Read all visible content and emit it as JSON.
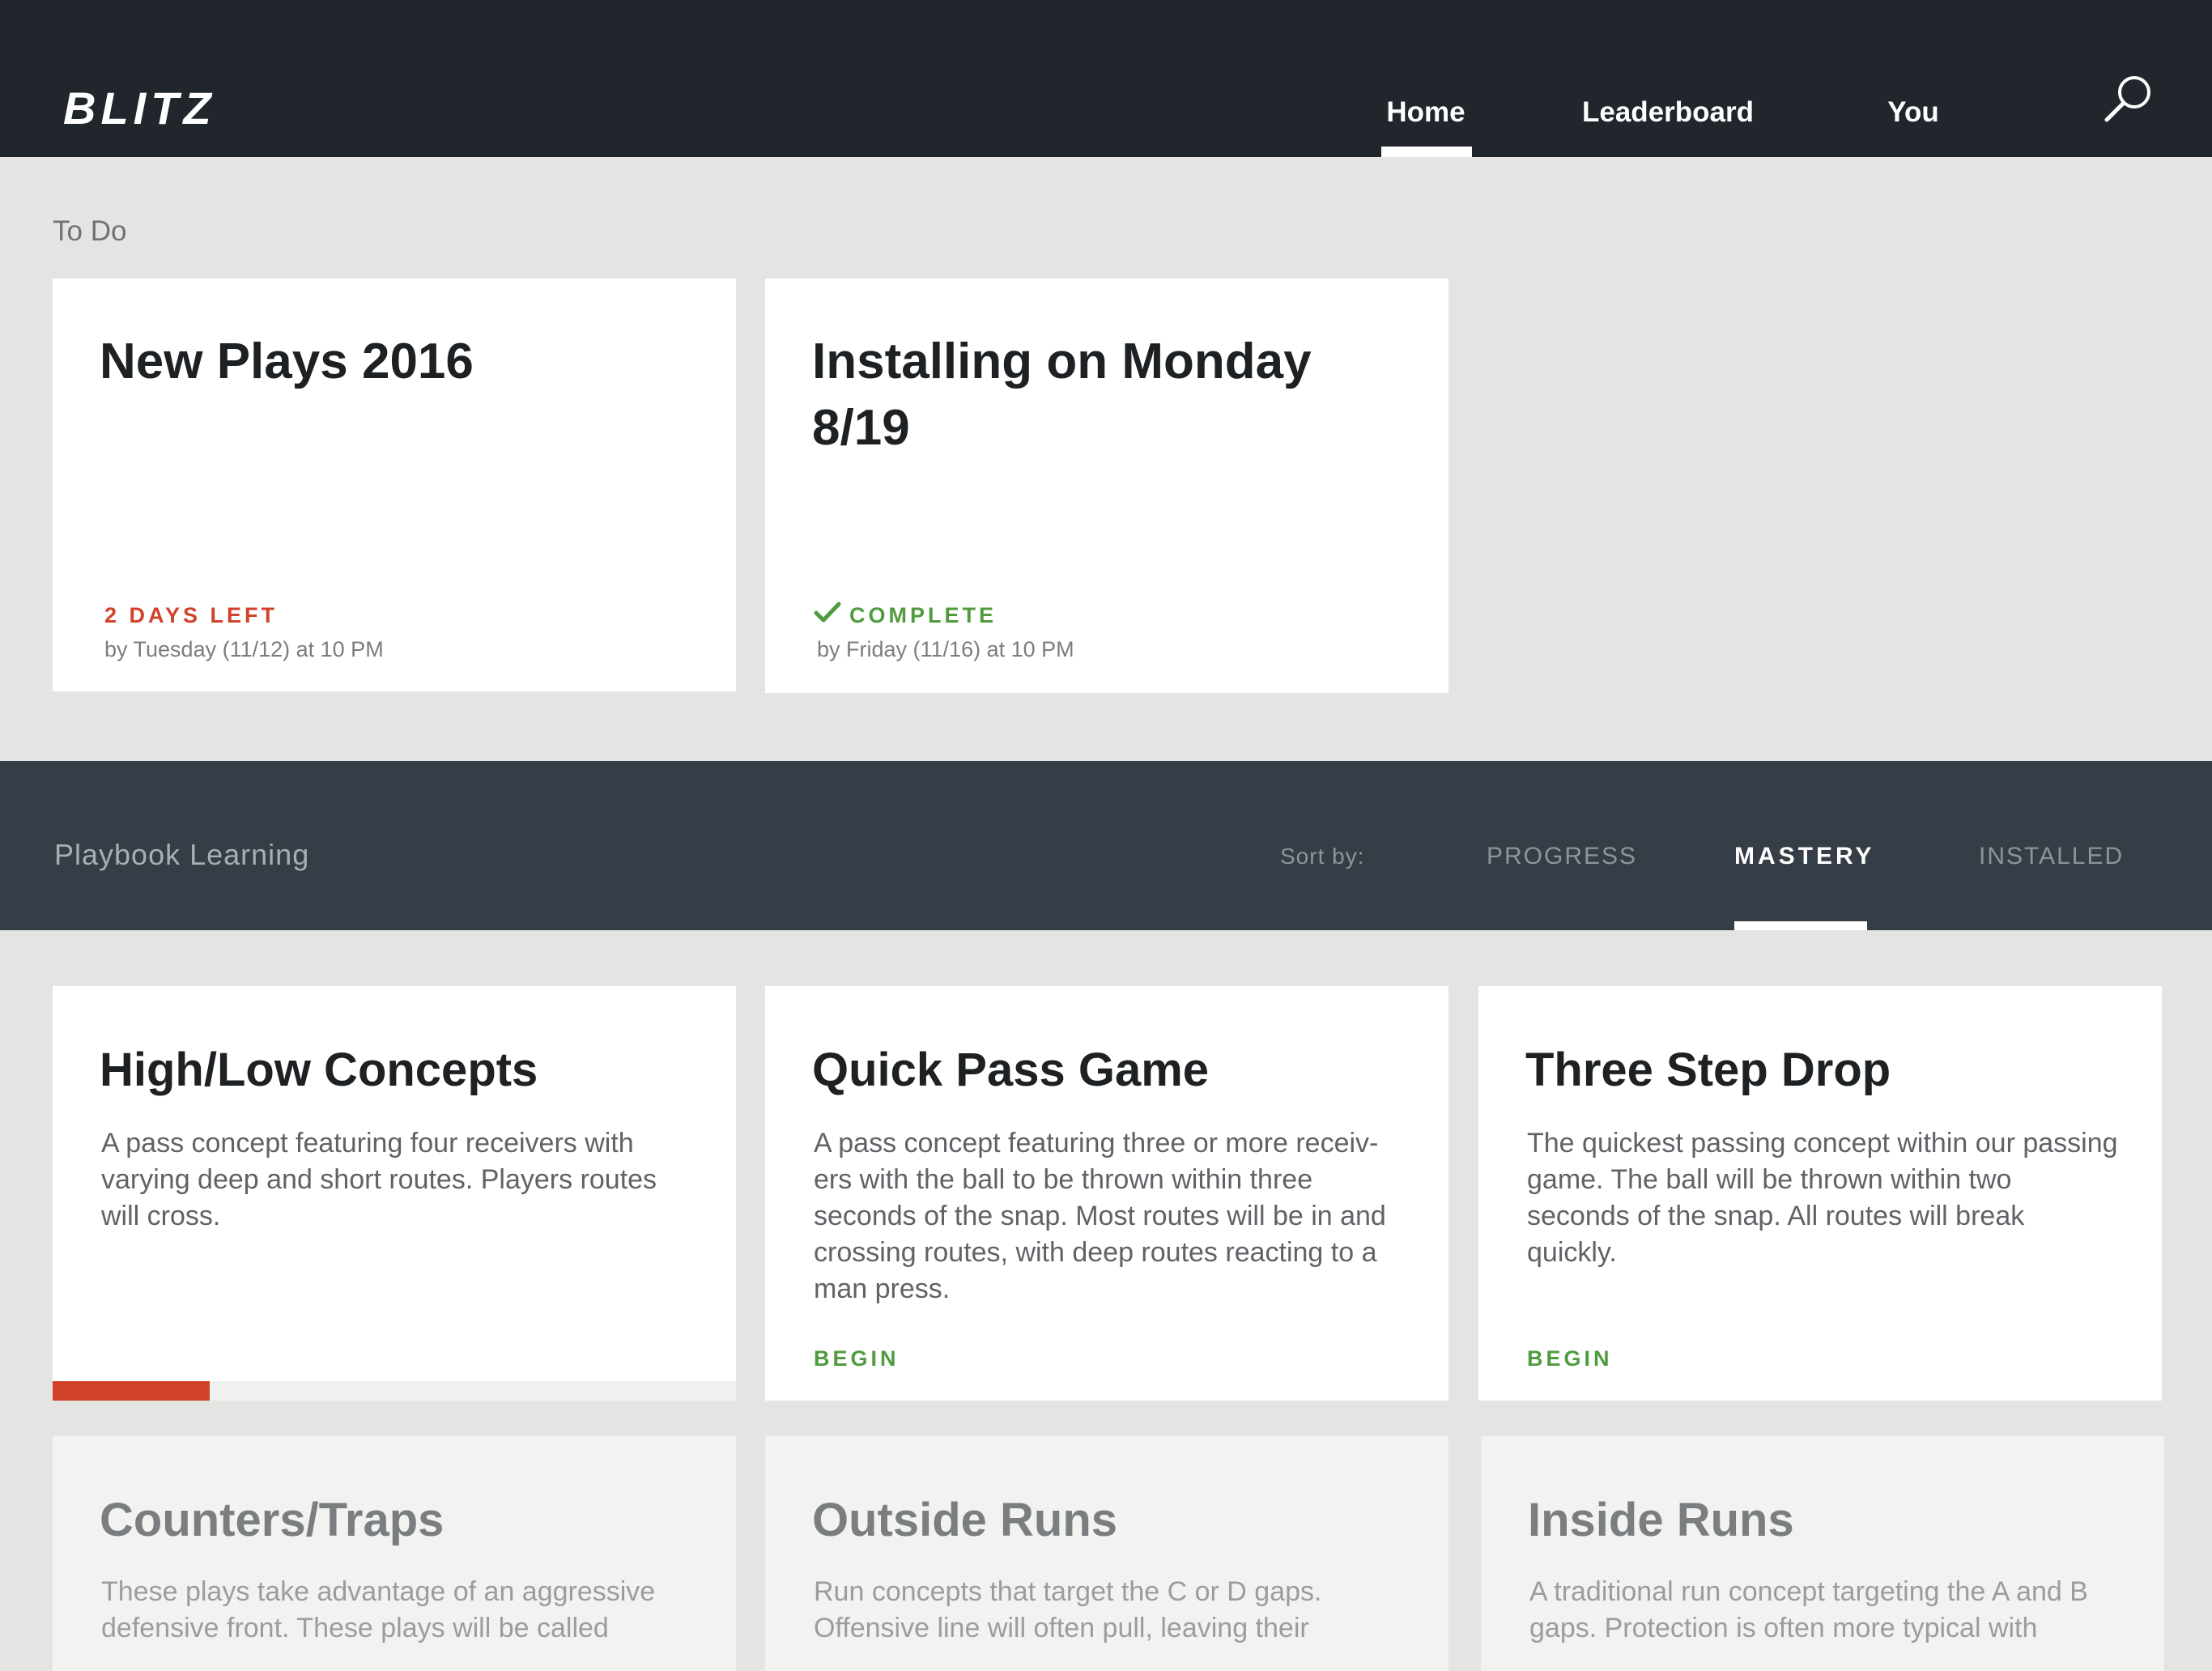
{
  "app": {
    "logo": "BLITZ",
    "nav": [
      {
        "label": "Home",
        "active": true
      },
      {
        "label": "Leaderboard",
        "active": false
      },
      {
        "label": "You",
        "active": false
      }
    ],
    "search_icon": "search-icon"
  },
  "todo": {
    "section_label": "To Do",
    "cards": [
      {
        "title": "New Plays 2016",
        "status": "2 DAYS LEFT",
        "status_color": "#d1422a",
        "due": "by Tuesday (11/12) at 10 PM"
      },
      {
        "title": "Installing on Monday 8/19",
        "status": "COMPLETE",
        "status_color": "#4f9b3e",
        "status_icon": "check-icon",
        "due": "by Friday (11/16) at 10 PM"
      }
    ]
  },
  "playbook": {
    "title": "Playbook Learning",
    "sort_label": "Sort by:",
    "sort_options": [
      {
        "label": "PROGRESS",
        "active": false
      },
      {
        "label": "MASTERY",
        "active": true
      },
      {
        "label": "INSTALLED",
        "active": false
      }
    ],
    "cards": [
      {
        "title": "High/Low Concepts",
        "description": "A pass concept featuring four receivers with varying deep and short routes. Players routes will cross.",
        "progress": 0.23
      },
      {
        "title": "Quick Pass Game",
        "description": "A pass concept featuring three or more receiv-ers with the ball to be thrown within three seconds of the snap. Most routes will be in and crossing routes, with deep routes reacting to a man press.",
        "action": "BEGIN"
      },
      {
        "title": "Three Step Drop",
        "description": "The quickest passing concept within our passing game. The ball will be thrown within two seconds of the snap. All routes will break quickly.",
        "action": "BEGIN"
      },
      {
        "title": "Counters/Traps",
        "description": "These plays take advantage of an aggressive defensive front. These plays will be called"
      },
      {
        "title": "Outside Runs",
        "description": "Run concepts that target the C or D gaps. Offensive line will often pull, leaving their"
      },
      {
        "title": "Inside Runs",
        "description": "A traditional run concept targeting the A and B gaps. Protection is often more typical with"
      }
    ]
  },
  "colors": {
    "header_bg": "#21262d",
    "playbook_bar_bg": "#353e46",
    "page_bg": "#e4e4e2",
    "accent_red": "#d1422a",
    "accent_green": "#4f9b3e"
  }
}
